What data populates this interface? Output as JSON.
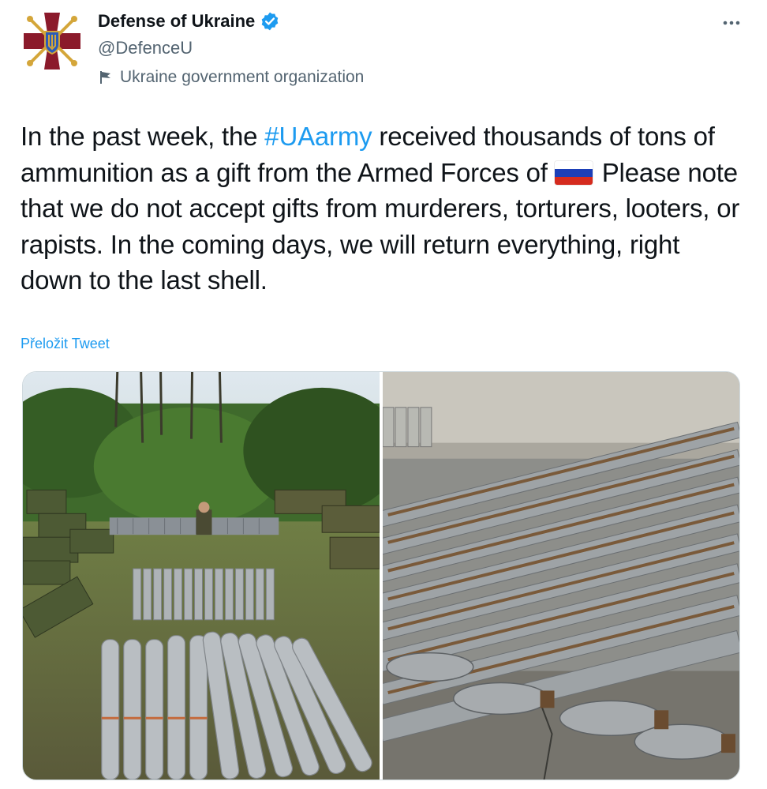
{
  "author": {
    "display_name": "Defense of Ukraine",
    "handle": "@DefenceU",
    "label": "Ukraine government organization",
    "verified": true,
    "avatar_icon": "ministry-of-defence-emblem-icon"
  },
  "tweet": {
    "text_before_hashtag": "In the past week, the ",
    "hashtag": "#UAarmy",
    "text_after_hashtag": " received thousands of tons of ammunition as a gift from the Armed Forces of ",
    "flag_emoji_icon": "russia-flag-icon",
    "text_after_flag": "Please note that we do not accept gifts from murderers, torturers, looters, or rapists. In the coming days, we will return everything, right down to the last shell."
  },
  "translate_label": "Přeložit Tweet",
  "media": [
    {
      "kind": "photo",
      "icon": "forest-ammunition-photo"
    },
    {
      "kind": "photo",
      "icon": "artillery-shells-photo"
    }
  ],
  "colors": {
    "accent": "#1d9bf0",
    "text_primary": "#0f1419",
    "text_secondary": "#536471",
    "verified": "#1d9bf0",
    "emblem_red": "#8b1a2b",
    "emblem_gold": "#d4a63a"
  },
  "icons": {
    "more": "more-icon",
    "verified": "verified-badge-icon",
    "flag": "government-flag-icon"
  }
}
